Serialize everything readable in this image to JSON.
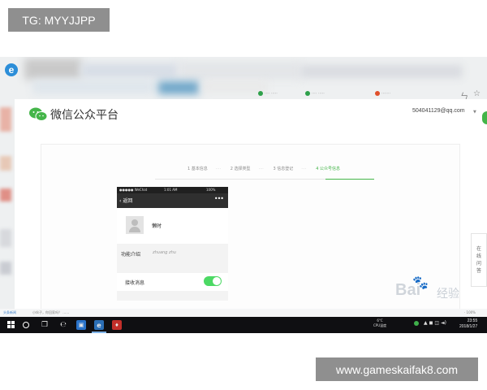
{
  "overlays": {
    "tg_label": "TG: MYYJJPP",
    "site_label": "www.gameskaifak8.com"
  },
  "browser": {
    "ie_logo_glyph": "e",
    "tabs": [
      {
        "label": "···· ·····",
        "dot_color": "#2ea04a"
      },
      {
        "label": "·······",
        "dot_color": "#e0502b"
      }
    ],
    "controls": [
      "ㄣ",
      "☆"
    ]
  },
  "mp": {
    "brand_color": "#44b549",
    "title": "微信公众平台",
    "account_email": "504041129@qq.com",
    "steps": [
      {
        "label": "1 基本信息",
        "active": false
      },
      {
        "label": "2 选择类型",
        "active": false
      },
      {
        "label": "3 信息登记",
        "active": false
      },
      {
        "label": "4 公众号信息",
        "active": true
      }
    ],
    "preview": {
      "status_carrier": "●●●●● WeChat",
      "status_time": "1:01 AM",
      "status_battery": "100%",
      "nav_back": "返回",
      "nav_more": "•••",
      "profile_name": "懒时",
      "func_label": "功能介绍",
      "func_value": "zhuang zhu",
      "receive_label": "接收消息",
      "receive_on": true
    },
    "side_feedback": [
      "在",
      "线",
      "问",
      "答"
    ]
  },
  "ie_status": {
    "left": "头条新闻",
    "middle": "小伙子，你回家吗？ ……",
    "right": "· 100%"
  },
  "watermark": {
    "brand": "Bai",
    "paw": "🐾",
    "suffix": "经验"
  },
  "taskbar": {
    "weather": [
      "6°C",
      "CPU温度"
    ],
    "time": "23:55",
    "date": "2018/1/27"
  }
}
